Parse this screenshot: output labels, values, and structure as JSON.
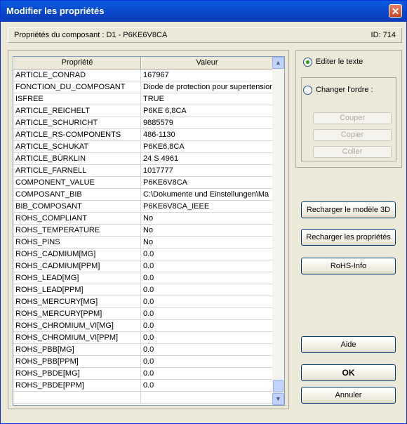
{
  "window": {
    "title": "Modifier les propriétés",
    "close_glyph": "✕"
  },
  "info": {
    "component_label": "Propriétés du composant : D1 - P6KE6V8CA",
    "id_label": "ID: 714"
  },
  "table": {
    "columns": [
      "Propriété",
      "Valeur"
    ],
    "rows": [
      {
        "property": "ARTICLE_CONRAD",
        "value": "167967"
      },
      {
        "property": "FONCTION_DU_COMPOSANT",
        "value": "Diode de protection pour supertension"
      },
      {
        "property": "ISFREE",
        "value": "TRUE"
      },
      {
        "property": "ARTICLE_REICHELT",
        "value": "P6KE 6,8CA"
      },
      {
        "property": "ARTICLE_SCHURICHT",
        "value": "9885579"
      },
      {
        "property": "ARTICLE_RS-COMPONENTS",
        "value": "486-1130"
      },
      {
        "property": "ARTICLE_SCHUKAT",
        "value": "P6KE6,8CA"
      },
      {
        "property": "ARTICLE_BÜRKLIN",
        "value": "24 S 4961"
      },
      {
        "property": "ARTICLE_FARNELL",
        "value": "1017777"
      },
      {
        "property": "COMPONENT_VALUE",
        "value": "P6KE6V8CA"
      },
      {
        "property": "COMPOSANT_BIB",
        "value": "C:\\Dokumente und Einstellungen\\Ma"
      },
      {
        "property": "BIB_COMPOSANT",
        "value": "P6KE6V8CA_IEEE"
      },
      {
        "property": "ROHS_COMPLIANT",
        "value": "No"
      },
      {
        "property": "ROHS_TEMPERATURE",
        "value": "No"
      },
      {
        "property": "ROHS_PINS",
        "value": "No"
      },
      {
        "property": "ROHS_CADMIUM[MG]",
        "value": "0.0"
      },
      {
        "property": "ROHS_CADMIUM[PPM]",
        "value": "0.0"
      },
      {
        "property": "ROHS_LEAD[MG]",
        "value": "0.0"
      },
      {
        "property": "ROHS_LEAD[PPM]",
        "value": "0.0"
      },
      {
        "property": "ROHS_MERCURY[MG]",
        "value": "0.0"
      },
      {
        "property": "ROHS_MERCURY[PPM]",
        "value": "0.0"
      },
      {
        "property": "ROHS_CHROMIUM_VI[MG]",
        "value": "0.0"
      },
      {
        "property": "ROHS_CHROMIUM_VI[PPM]",
        "value": "0.0"
      },
      {
        "property": "ROHS_PBB[MG]",
        "value": "0.0"
      },
      {
        "property": "ROHS_PBB[PPM]",
        "value": "0.0"
      },
      {
        "property": "ROHS_PBDE[MG]",
        "value": "0.0"
      },
      {
        "property": "ROHS_PBDE[PPM]",
        "value": "0.0"
      },
      {
        "property": "",
        "value": ""
      }
    ]
  },
  "options": {
    "edit_text_label": "Editer le texte",
    "change_order_label": "Changer l'ordre :",
    "selected": "edit_text",
    "cut_label": "Couper",
    "copy_label": "Copier",
    "paste_label": "Coller"
  },
  "buttons": {
    "reload_3d": "Recharger le modèle 3D",
    "reload_props": "Recharger les propriétés",
    "rohs_info": "RoHS-Info",
    "help": "Aide",
    "ok": "OK",
    "cancel": "Annuler"
  },
  "scroll": {
    "up_glyph": "▲",
    "down_glyph": "▼"
  }
}
